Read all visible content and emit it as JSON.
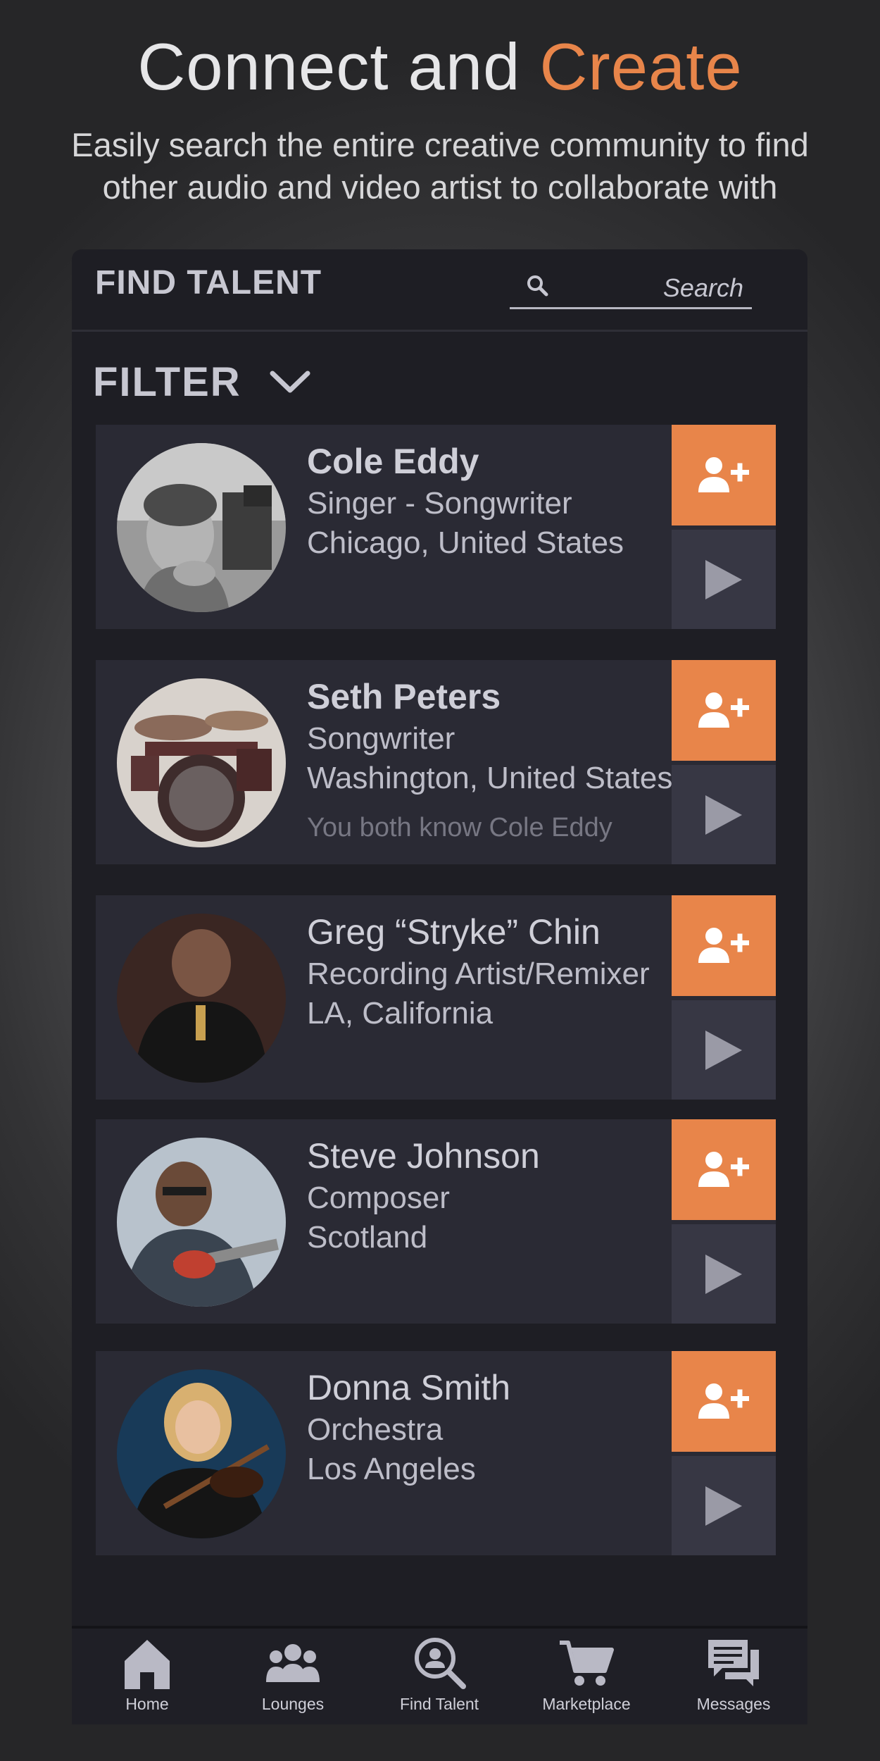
{
  "hero": {
    "title_part1": "Connect and ",
    "title_accent": "Create",
    "subtitle": "Easily search the entire creative community to find other audio and video artist to collaborate with"
  },
  "header": {
    "title": "FIND TALENT",
    "search_placeholder": "Search"
  },
  "filter": {
    "label": "FILTER"
  },
  "talent": [
    {
      "name": "Cole Eddy",
      "role": "Singer - Songwriter",
      "location": "Chicago, United States",
      "mutual": ""
    },
    {
      "name": "Seth Peters",
      "role": "Songwriter",
      "location": "Washington, United States",
      "mutual": "You both know Cole Eddy"
    },
    {
      "name": "Greg “Stryke” Chin",
      "role": "Recording Artist/Remixer",
      "location": "LA, California",
      "mutual": ""
    },
    {
      "name": "Steve Johnson",
      "role": "Composer",
      "location": "Scotland",
      "mutual": ""
    },
    {
      "name": "Donna Smith",
      "role": "Orchestra",
      "location": "Los Angeles",
      "mutual": ""
    }
  ],
  "nav": {
    "items": [
      {
        "label": "Home",
        "icon": "home-icon"
      },
      {
        "label": "Lounges",
        "icon": "users-icon"
      },
      {
        "label": "Find Talent",
        "icon": "search-person-icon"
      },
      {
        "label": "Marketplace",
        "icon": "cart-icon"
      },
      {
        "label": "Messages",
        "icon": "messages-icon"
      }
    ]
  },
  "colors": {
    "accent": "#e8854a",
    "panel": "#1e1e24",
    "card": "#2a2a34",
    "play_bg": "#373744"
  }
}
